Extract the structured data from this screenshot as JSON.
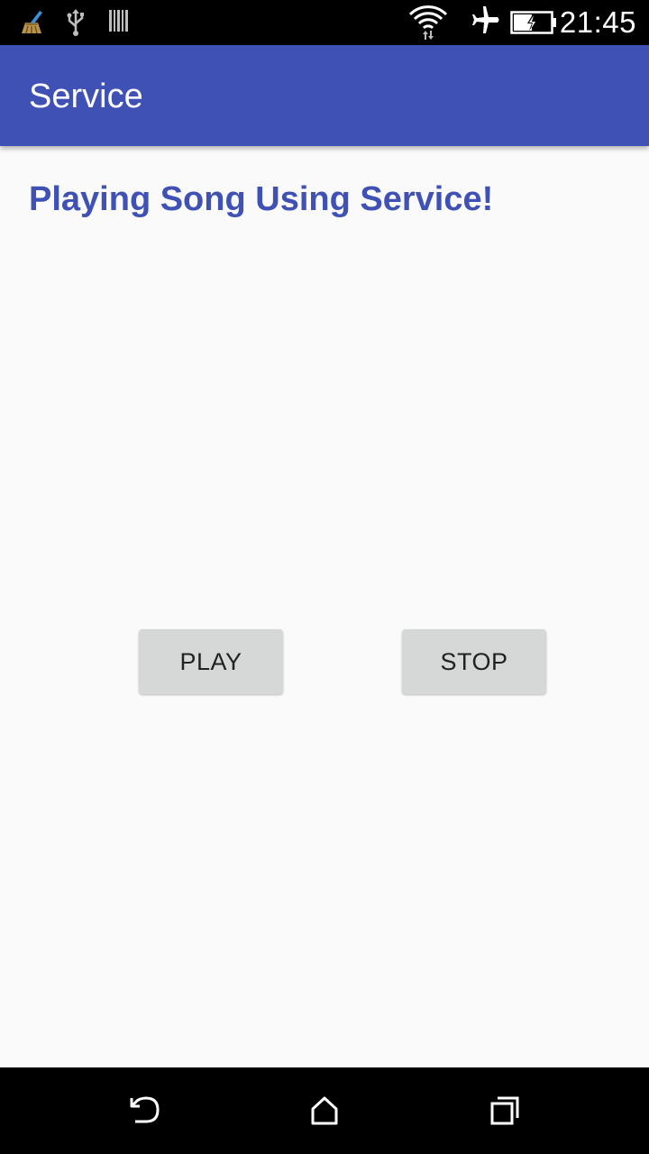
{
  "status_bar": {
    "time": "21:45",
    "icons": [
      "cleaner-app-icon",
      "usb-icon",
      "barcode-icon",
      "wifi-icon",
      "airplane-mode-icon",
      "battery-charging-icon"
    ]
  },
  "app_bar": {
    "title": "Service"
  },
  "main": {
    "heading": "Playing Song Using Service!",
    "play_button_label": "PLAY",
    "stop_button_label": "STOP"
  },
  "nav_bar": {
    "buttons": [
      "back-icon",
      "home-icon",
      "recents-icon"
    ]
  },
  "colors": {
    "primary": "#3f51b5",
    "background": "#fafafa",
    "button": "#d6d7d7"
  }
}
